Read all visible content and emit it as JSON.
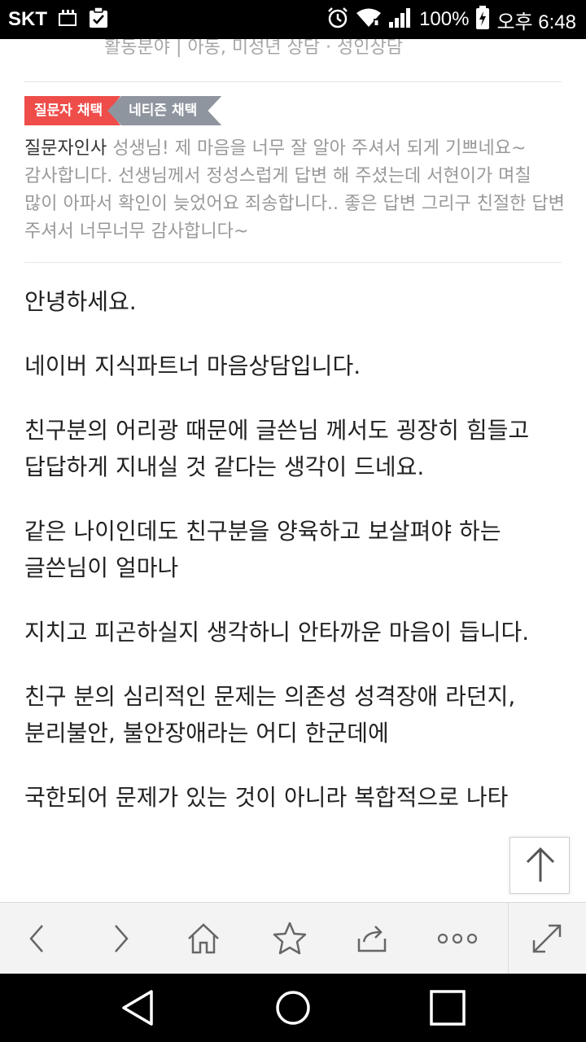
{
  "status_bar": {
    "carrier": "SKT",
    "battery_percent": "100%",
    "time": "오후 6:48"
  },
  "field_line": "활동분야 | 아동, 미성년 상담 · 성인상담",
  "tags": {
    "questioner_pick": "질문자 채택",
    "netizen_pick": "네티즌 채택"
  },
  "greeting": {
    "label": "질문자인사",
    "text": " 성생님! 제 마음을 너무 잘 알아 주셔서 되게 기쁘네요~ 감사합니다. 선생님께서 정성스럽게 답변 해 주셨는데 서현이가 며칠 많이 아파서 확인이 늦었어요 죄송합니다.. 좋은 답변 그리구 친절한 답변 주셔서 너무너무 감사합니다~"
  },
  "answer": {
    "paragraphs": [
      "안녕하세요.",
      "네이버 지식파트너 마음상담입니다.",
      "친구분의 어리광 때문에 글쓴님 께서도 굉장히 힘들고 답답하게 지내실 것 같다는 생각이 드네요.",
      "같은 나이인데도 친구분을 양육하고 보살펴야 하는 글쓴님이 얼마나",
      "지치고 피곤하실지 생각하니 안타까운 마음이 듭니다.",
      "친구 분의 심리적인 문제는 의존성 성격장애 라던지, 분리불안, 불안장애라는 어디 한군데에"
    ],
    "partial": "국한되어 문제가 있는 것이 아니라 복합적으로 나타"
  },
  "colors": {
    "tag_red": "#ee4d49",
    "tag_gray": "#8f959e"
  }
}
